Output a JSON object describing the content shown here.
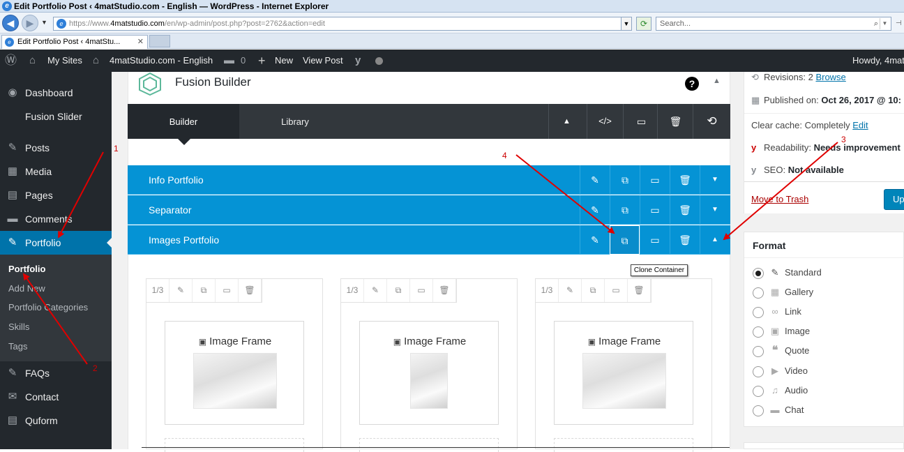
{
  "window": {
    "title": "Edit Portfolio Post ‹ 4matStudio.com - English — WordPress - Internet Explorer"
  },
  "browser": {
    "url_scheme": "https://www.",
    "url_host": "4matstudio.com",
    "url_path": "/en/wp-admin/post.php?post=2762&action=edit",
    "search_placeholder": "Search...",
    "tab_title": "Edit Portfolio Post ‹ 4matStu..."
  },
  "adminbar": {
    "my_sites": "My Sites",
    "site_name": "4matStudio.com - English",
    "comments_count": "0",
    "new": "New",
    "view_post": "View Post",
    "howdy": "Howdy, 4mat"
  },
  "sidebar": {
    "items": [
      {
        "label": "Dashboard",
        "icon": "dashboard-icon"
      },
      {
        "label": "Fusion Slider",
        "icon": ""
      },
      {
        "label": "Posts",
        "icon": "pin-icon"
      },
      {
        "label": "Media",
        "icon": "media-icon"
      },
      {
        "label": "Pages",
        "icon": "pages-icon"
      },
      {
        "label": "Comments",
        "icon": "comment-icon"
      },
      {
        "label": "Portfolio",
        "icon": "pin-icon"
      },
      {
        "label": "FAQs",
        "icon": "pin-icon"
      },
      {
        "label": "Contact",
        "icon": "mail-icon"
      },
      {
        "label": "Quform",
        "icon": "form-icon"
      }
    ],
    "submenu": [
      "Portfolio",
      "Add New",
      "Portfolio Categories",
      "Skills",
      "Tags"
    ]
  },
  "builder": {
    "title": "Fusion Builder",
    "help": "?",
    "tabs": [
      "Builder",
      "Library"
    ],
    "containers": [
      {
        "name": "Info Portfolio"
      },
      {
        "name": "Separator"
      },
      {
        "name": "Images Portfolio"
      }
    ],
    "tooltip": "Clone Container",
    "column_size": "1/3",
    "element_title": "Image Frame"
  },
  "publish": {
    "revisions_label": "Revisions: 2",
    "revisions_link": "Browse",
    "published_label": "Published on:",
    "published_value": "Oct 26, 2017 @ 10:",
    "cache_label": "Clear cache: Completely",
    "cache_link": "Edit",
    "readability_label": "Readability:",
    "readability_value": "Needs improvement",
    "seo_label": "SEO:",
    "seo_value": "Not available",
    "trash": "Move to Trash",
    "update": "Up"
  },
  "format": {
    "title": "Format",
    "options": [
      {
        "label": "Standard",
        "selected": true
      },
      {
        "label": "Gallery",
        "selected": false
      },
      {
        "label": "Link",
        "selected": false
      },
      {
        "label": "Image",
        "selected": false
      },
      {
        "label": "Quote",
        "selected": false
      },
      {
        "label": "Video",
        "selected": false
      },
      {
        "label": "Audio",
        "selected": false
      },
      {
        "label": "Chat",
        "selected": false
      }
    ]
  },
  "annotations": [
    "1",
    "2",
    "3",
    "4"
  ],
  "colors": {
    "wp_blue": "#0073aa",
    "container_blue": "#0593d5",
    "admin_dark": "#23282d",
    "arrow_red": "#e00000"
  }
}
